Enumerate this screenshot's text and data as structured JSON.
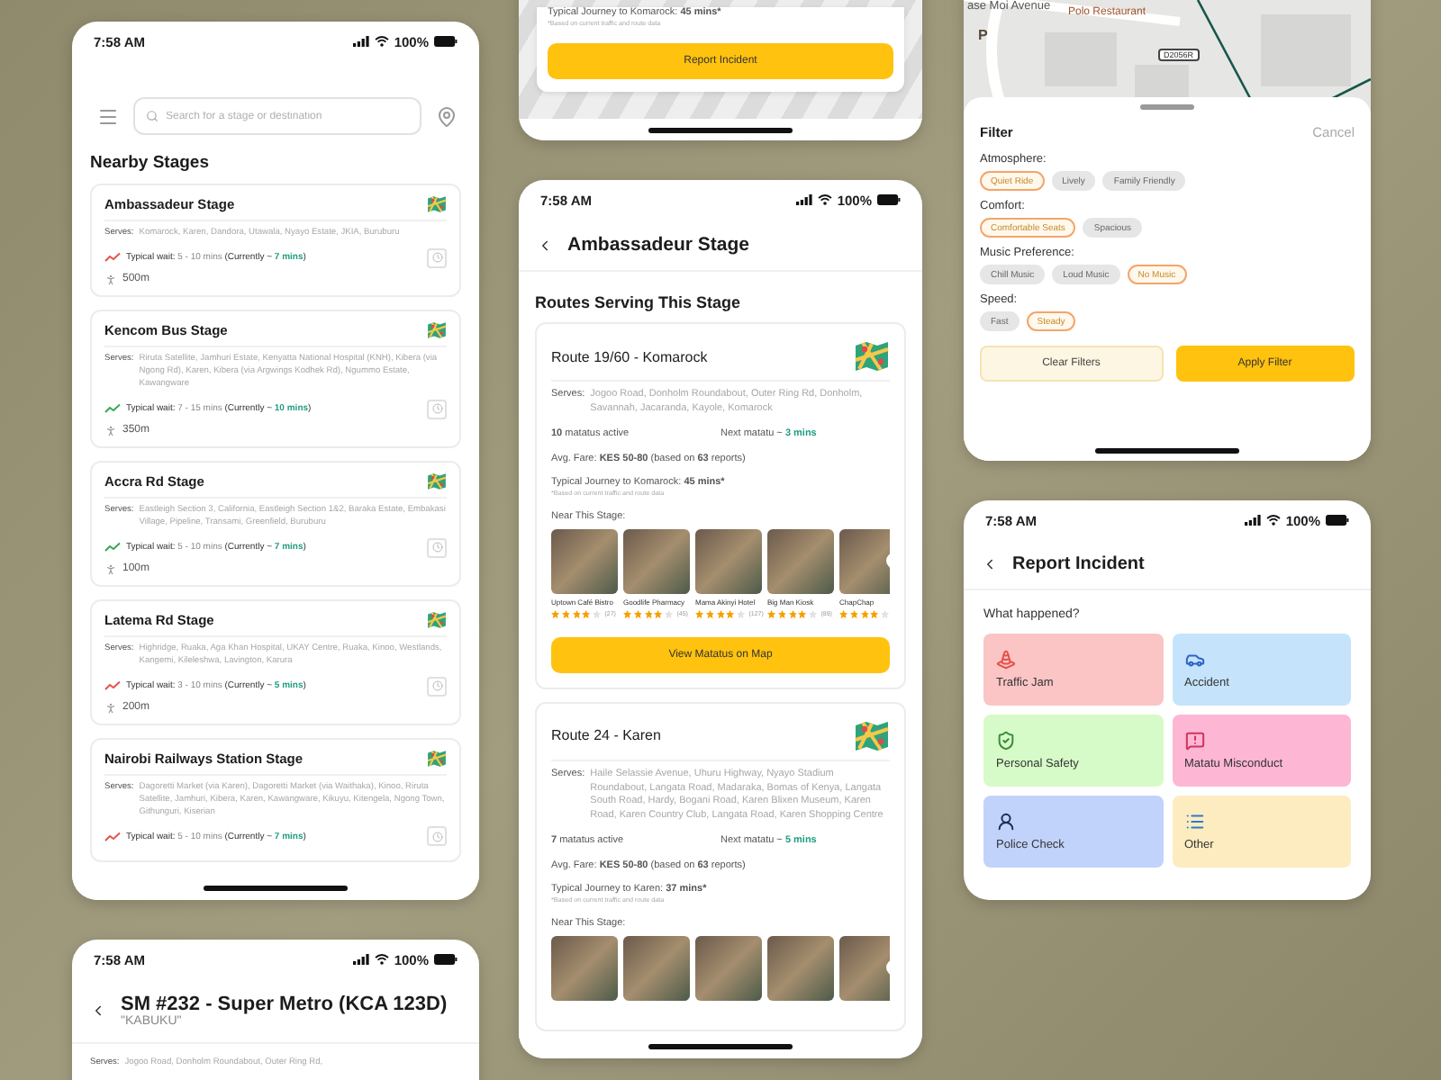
{
  "nearby_screen": {
    "status_bar": {
      "time": "7:58 AM",
      "battery": "100%"
    },
    "search": {
      "placeholder": "Search for a stage or destination"
    },
    "title": "Nearby Stages",
    "stages": [
      {
        "name": "Ambassadeur Stage",
        "serves_label": "Serves:",
        "serves": "Komarock, Karen, Dandora, Utawala, Nyayo Estate, JKIA, Buruburu",
        "color": "#e5534b",
        "wait_label": "Typical wait:",
        "wait": "5 - 10 mins",
        "current_label": "(Currently ~",
        "current": "7 mins",
        "current_end": ")",
        "distance": "500m"
      },
      {
        "name": "Kencom Bus Stage",
        "serves_label": "Serves:",
        "serves": "Riruta Satellite, Jamhuri Estate, Kenyatta National Hospital (KNH), Kibera (via Ngong Rd), Karen, Kibera (via Argwings Kodhek Rd), Ngummo Estate, Kawangware",
        "color": "#35a853",
        "wait_label": "Typical wait:",
        "wait": "7 - 15 mins",
        "current_label": "(Currently ~",
        "current": "10 mins",
        "current_end": ")",
        "distance": "350m"
      },
      {
        "name": "Accra Rd Stage",
        "serves_label": "Serves:",
        "serves": "Eastleigh Section 3, California, Eastleigh Section 1&2, Baraka Estate, Embakasi Village, Pipeline, Transami, Greenfield, Buruburu",
        "color": "#35a853",
        "wait_label": "Typical wait:",
        "wait": "5 - 10 mins",
        "current_label": "(Currently ~",
        "current": "7 mins",
        "current_end": ")",
        "distance": "100m"
      },
      {
        "name": "Latema Rd Stage",
        "serves_label": "Serves:",
        "serves": "Highridge, Ruaka, Aga Khan Hospital, UKAY Centre, Ruaka, Kinoo, Westlands, Kangemi, Kileleshwa, Lavington, Karura",
        "color": "#e5534b",
        "wait_label": "Typical wait:",
        "wait": "3 - 10 mins",
        "current_label": "(Currently ~",
        "current": "5 mins",
        "current_end": ")",
        "distance": "200m"
      },
      {
        "name": "Nairobi Railways Station Stage",
        "serves_label": "Serves:",
        "serves": "Dagoretti Market (via Karen), Dagoretti Market (via Waithaka), Kinoo, Riruta Satellite, Jamhuri, Kibera, Karen, Kawangware, Kikuyu, Kitengela, Ngong Town, Githunguri, Kiserian",
        "color": "#e5534b",
        "wait_label": "Typical wait:",
        "wait": "5 - 10 mins",
        "current_label": "(Currently ~",
        "current": "7 mins",
        "current_end": ")"
      }
    ]
  },
  "vehicle_screen": {
    "status_bar": {
      "time": "7:58 AM",
      "battery": "100%"
    },
    "title": "SM #232 - Super Metro (KCA 123D)",
    "nickname": "\"KABUKU\"",
    "serves_label": "Serves:",
    "serves": "Jogoo Road, Donholm Roundabout, Outer Ring Rd,"
  },
  "route_detail_screen": {
    "journey_label": "Typical Journey to Komarock:",
    "journey_value": "45 mins*",
    "footnote": "*Based on current traffic and route data",
    "button": "Report Incident"
  },
  "stage_screen": {
    "status_bar": {
      "time": "7:58 AM",
      "battery": "100%"
    },
    "title": "Ambassadeur Stage",
    "section_title": "Routes Serving This Stage",
    "routes": [
      {
        "name": "Route 19/60 - Komarock",
        "serves_label": "Serves:",
        "serves": "Jogoo Road, Donholm Roundabout, Outer Ring Rd, Donholm, Savannah, Jacaranda, Kayole, Komarock",
        "active": "**10** matatus active",
        "next_label": "Next matatu ~",
        "next": "3 mins",
        "fare": "Avg. Fare: **KES 50-80** (based on **63** reports)",
        "journey_label": "Typical Journey to Komarock:",
        "journey_value": "45 mins*",
        "footnote": "*Based on current traffic and route data",
        "near_label": "Near This Stage:",
        "places": [
          {
            "kind": "listing",
            "name": "Uptown Café Bistro",
            "stars": 4,
            "reviews": "(27)"
          },
          {
            "kind": "listing",
            "name": "Goodlife Pharmacy",
            "stars": 4,
            "reviews": "(45)"
          },
          {
            "kind": "listing",
            "name": "Mama Akinyi Hotel",
            "stars": 4,
            "reviews": "(127)"
          },
          {
            "kind": "listing",
            "name": "Big Man Kiosk",
            "stars": 4,
            "reviews": "(89)"
          },
          {
            "kind": "listing",
            "name": "ChapChap",
            "stars": 4
          }
        ],
        "button": "View Matatus on Map"
      },
      {
        "name": "Route 24 - Karen",
        "serves_label": "Serves:",
        "serves": "Haile Selassie Avenue, Uhuru Highway, Nyayo Stadium Roundabout, Langata Road, Madaraka, Bomas of Kenya, Langata South Road, Hardy, Bogani Road, Karen Blixen Museum, Karen Road, Karen Country Club, Langata Road, Karen Shopping Centre",
        "active": "**7** matatus active",
        "next_label": "Next matatu ~",
        "next": "5 mins",
        "fare": "Avg. Fare: **KES 50-80** (based on **63** reports)",
        "journey_label": "Typical Journey to Karen:",
        "journey_value": "37 mins*",
        "footnote": "*Based on current traffic and route data",
        "near_label": "Near This Stage:",
        "places": [
          {
            "kind": "photo"
          },
          {
            "kind": "photo"
          },
          {
            "kind": "photo"
          },
          {
            "kind": "photo"
          },
          {
            "kind": "photo"
          }
        ]
      }
    ]
  },
  "filter_screen": {
    "map_labels": [
      {
        "text": "ase Moi Avenue"
      },
      {
        "text": "Polo Restaurant"
      },
      {
        "text": "P"
      },
      {
        "text": "D2056R"
      }
    ],
    "title": "Filter",
    "cancel": "Cancel",
    "groups": [
      {
        "label": "Atmosphere:",
        "options": [
          {
            "label": "Quiet Ride",
            "selected": true
          },
          {
            "label": "Lively",
            "selected": false
          },
          {
            "label": "Family Friendly",
            "selected": false
          }
        ]
      },
      {
        "label": "Comfort:",
        "options": [
          {
            "label": "Comfortable Seats",
            "selected": true
          },
          {
            "label": "Spacious",
            "selected": false
          }
        ]
      },
      {
        "label": "Music Preference:",
        "options": [
          {
            "label": "Chill Music",
            "selected": false
          },
          {
            "label": "Loud Music",
            "selected": false
          },
          {
            "label": "No Music",
            "selected": true
          }
        ]
      },
      {
        "label": "Speed:",
        "options": [
          {
            "label": "Fast",
            "selected": false
          },
          {
            "label": "Steady",
            "selected": true
          }
        ]
      }
    ],
    "clear_button": "Clear Filters",
    "apply_button": "Apply Filter"
  },
  "incident_screen": {
    "status_bar": {
      "time": "7:58 AM",
      "battery": "100%"
    },
    "title": "Report Incident",
    "question": "What happened?",
    "options": [
      {
        "label": "Traffic Jam",
        "kind": "traffic",
        "color": "#fbc5c5"
      },
      {
        "label": "Accident",
        "kind": "accident",
        "color": "#c5e4fb"
      },
      {
        "label": "Personal Safety",
        "kind": "safety",
        "color": "#d6fbc8"
      },
      {
        "label": "Matatu Misconduct",
        "kind": "misconduct",
        "color": "#fdb6d3"
      },
      {
        "label": "Police Check",
        "kind": "police",
        "color": "#c2d3fb"
      },
      {
        "label": "Other",
        "kind": "other",
        "color": "#fdecc0"
      }
    ]
  }
}
